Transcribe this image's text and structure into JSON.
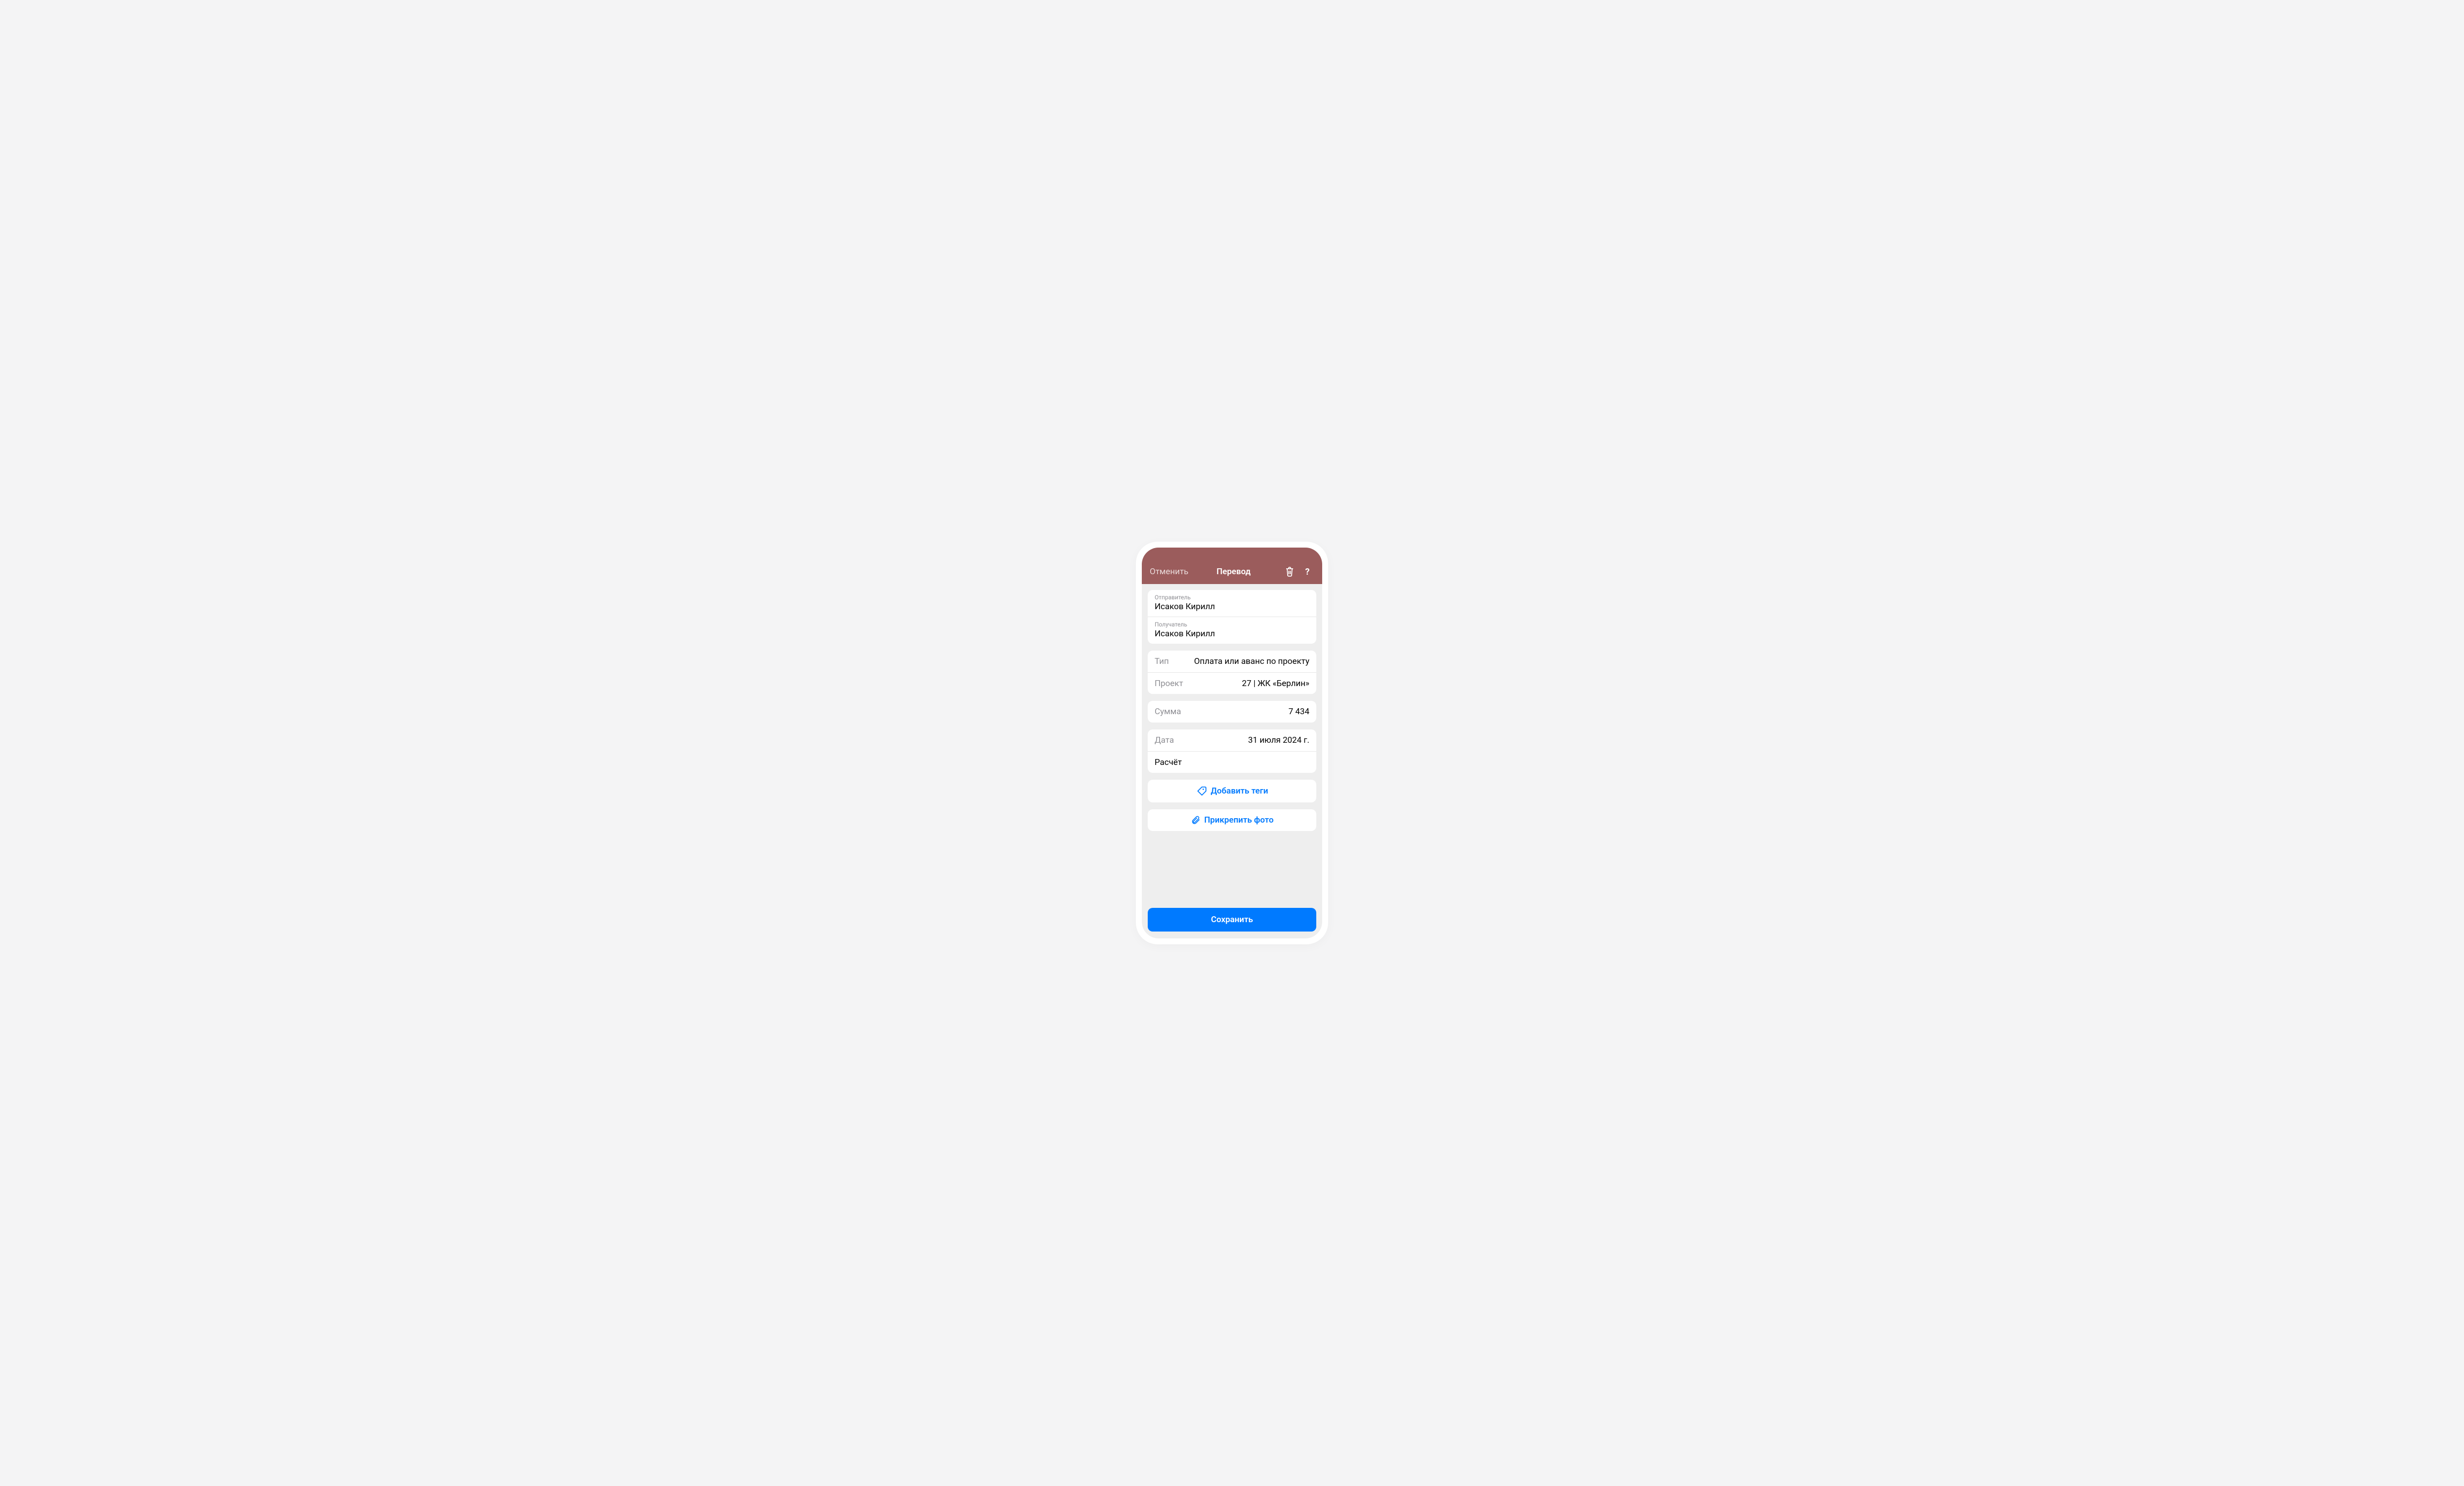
{
  "header": {
    "cancel": "Отменить",
    "title": "Перевод"
  },
  "sender": {
    "label": "Отправитель",
    "value": "Исаков Кирилл"
  },
  "recipient": {
    "label": "Получатель",
    "value": "Исаков Кирилл"
  },
  "type": {
    "label": "Тип",
    "value": "Оплата или аванс по проекту"
  },
  "project": {
    "label": "Проект",
    "value": "27 | ЖК «Берлин»"
  },
  "amount": {
    "label": "Сумма",
    "value": "7 434"
  },
  "date": {
    "label": "Дата",
    "value": "31 июля 2024 г."
  },
  "note": "Расчёт",
  "actions": {
    "add_tags": "Добавить теги",
    "attach_photo": "Прикрепить фото",
    "save": "Сохранить"
  }
}
